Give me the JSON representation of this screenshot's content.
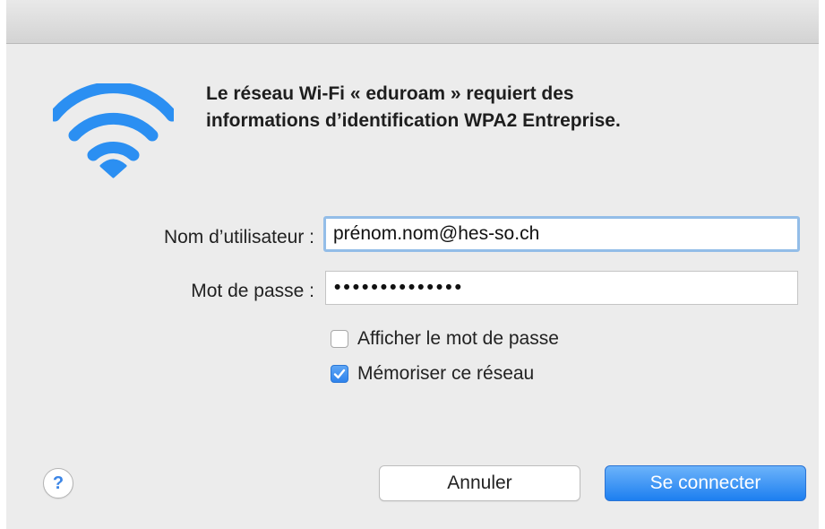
{
  "dialog": {
    "title_line1": "Le réseau Wi-Fi « eduroam » requiert des",
    "title_line2": "informations d’identification WPA2 Entreprise.",
    "icon": "wifi-icon",
    "accent_color": "#2b8ff2"
  },
  "form": {
    "username_label": "Nom d’utilisateur :",
    "username_value": "prénom.nom@hes-so.ch",
    "password_label": "Mot de passe :",
    "password_value": "••••••••••••••"
  },
  "options": {
    "show_password_label": "Afficher le mot de passe",
    "show_password_checked": false,
    "remember_label": "Mémoriser ce réseau",
    "remember_checked": true
  },
  "buttons": {
    "help_label": "?",
    "cancel_label": "Annuler",
    "connect_label": "Se connecter"
  }
}
